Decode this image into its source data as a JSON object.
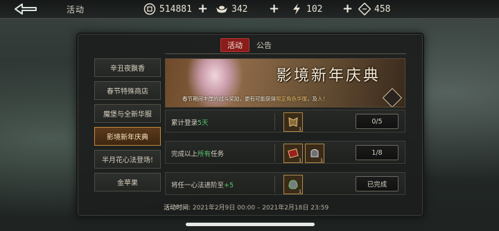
{
  "topbar": {
    "title": "活动",
    "resources": [
      {
        "icon": "coin-icon",
        "value": "514881"
      },
      {
        "icon": "ingot-icon",
        "value": "342"
      },
      {
        "icon": "lightning-icon",
        "value": "102"
      },
      {
        "icon": "ticket-icon",
        "value": "458"
      }
    ],
    "plus": "+"
  },
  "tabs": [
    {
      "label": "活动",
      "active": true
    },
    {
      "label": "公告",
      "active": false
    }
  ],
  "sidebar": {
    "items": [
      {
        "label": "辛丑夜飘香"
      },
      {
        "label": "春节特殊商店"
      },
      {
        "label": "魔堡与全新华服"
      },
      {
        "label": "影境新年庆典",
        "active": true
      },
      {
        "label": "半月花心法登场!"
      },
      {
        "label": "金苹果"
      }
    ]
  },
  "banner": {
    "title": "影境新年庆典",
    "subtitle_pre": "春节期间丰厚的战斗奖励，更有可能获得",
    "subtitle_hl": "限定角色华服",
    "subtitle_post": "，及",
    "subtitle_end": "人！"
  },
  "tasks": [
    {
      "label_pre": "累计登录",
      "label_hl": "5天",
      "label_post": "",
      "rewards": [
        {
          "icon": "armor-icon",
          "count": "1"
        }
      ],
      "button": "0/5"
    },
    {
      "label_pre": "完成以上",
      "label_hl": "所有",
      "label_post": "任务",
      "rewards": [
        {
          "icon": "scroll-icon",
          "count": "1"
        },
        {
          "icon": "chest-icon",
          "count": "1"
        }
      ],
      "button": "1/8"
    },
    {
      "label_pre": "将任一心法进阶至",
      "label_hl": "+5",
      "label_post": "",
      "rewards": [
        {
          "icon": "helmet-icon",
          "count": "1"
        }
      ],
      "button": "已完成"
    }
  ],
  "footer": {
    "key": "活动时间:",
    "value": "2021年2月9日 00:00 – 2021年2月18日 23:59"
  }
}
